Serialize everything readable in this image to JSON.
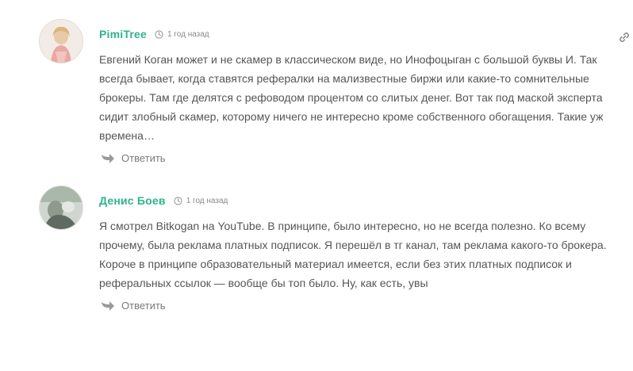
{
  "comments": [
    {
      "author": "PimiTree",
      "date": "1 год назад",
      "text": "Евгений Коган может и не скамер в классическом виде, но Инофоцыган с большой буквы И. Так всегда бывает, когда ставятся рефералки на мализвестные биржи или какие-то сомнительные брокеры. Там где делятся с рефоводом процентом со слитых денег. Вот так под маской эксперта сидит злобный скамер, которому ничего не интересно кроме собственного обогащения. Такие уж времена…",
      "reply_label": "Ответить",
      "icons": {
        "avatar": "user-photo-avatar",
        "date": "clock-icon",
        "reply": "reply-arrow-icon",
        "permalink": "link-icon"
      }
    },
    {
      "author": "Денис Боев",
      "date": "1 год назад",
      "text": "Я смотрел Bitkogan на YouTube. В принципе, было интересно, но не всегда полезно. Ко всему прочему, была реклама платных подписок. Я перешёл в тг канал, там реклама какого-то брокера. Короче в принципе образовательный материал имеется, если без этих платных подписок и реферальных ссылок — вообще бы топ было. Ну, как есть, увы",
      "reply_label": "Ответить",
      "icons": {
        "avatar": "user-photo-avatar",
        "date": "clock-icon",
        "reply": "reply-arrow-icon"
      }
    }
  ],
  "colors": {
    "author": "#2fb48c",
    "text": "#555555",
    "meta": "#8a8a8a",
    "reply": "#7a7a7a"
  }
}
